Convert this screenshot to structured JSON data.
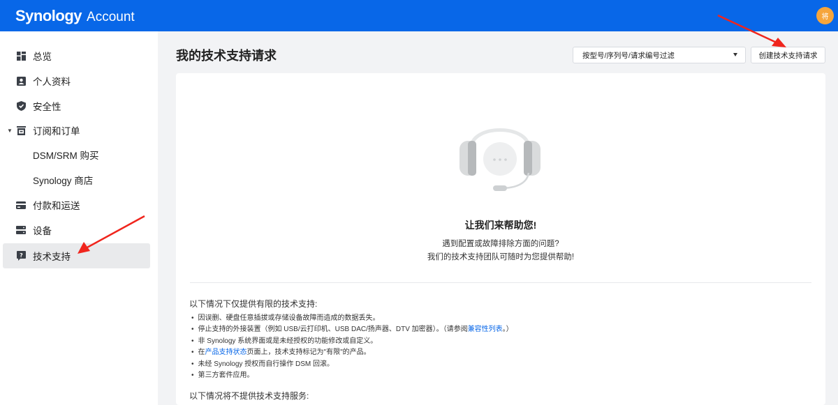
{
  "header": {
    "brand": "Synology",
    "product": "Account",
    "avatar_text": "将",
    "bar_color": "#0867e8"
  },
  "sidebar": {
    "items": [
      {
        "label": "总览",
        "icon": "dashboard-icon"
      },
      {
        "label": "个人资料",
        "icon": "profile-icon"
      },
      {
        "label": "安全性",
        "icon": "shield-icon"
      },
      {
        "label": "订阅和订单",
        "icon": "orders-icon",
        "expanded": true
      },
      {
        "label": "DSM/SRM 购买",
        "sub": true
      },
      {
        "label": "Synology 商店",
        "sub": true
      },
      {
        "label": "付款和运送",
        "icon": "credit-card-icon"
      },
      {
        "label": "设备",
        "icon": "device-icon"
      },
      {
        "label": "技术支持",
        "icon": "support-icon",
        "active": true
      }
    ]
  },
  "main": {
    "title": "我的技术支持请求",
    "filter_placeholder": "按型号/序列号/请求编号过滤",
    "create_button": "创建技术支持请求"
  },
  "help": {
    "title": "让我们来帮助您!",
    "line1": "遇到配置或故障排除方面的问题?",
    "line2": "我们的技术支持团队可随时为您提供帮助!"
  },
  "limited": {
    "heading": "以下情况下仅提供有限的技术支持:",
    "items": [
      "因误删、硬盘任意插拔或存储设备故障而造成的数据丢失。",
      {
        "before": "停止支持的外接装置（例如 USB/云打印机、USB DAC/扬声器、DTV 加密器）。（请参阅",
        "link": "兼容性列表",
        "after": "。）"
      },
      "非 Synology 系统界面或是未经授权的功能修改或自定义。",
      {
        "before": "在",
        "link": "产品支持状态",
        "after": "页面上，技术支持标记为\"有限\"的产品。"
      },
      "未经 Synology 授权而自行操作 DSM 回滚。",
      "第三方套件应用。"
    ]
  },
  "no_support": {
    "heading": "以下情况将不提供技术支持服务:"
  },
  "colors": {
    "accent": "#0867e8",
    "annotation_arrow": "#f0251d",
    "avatar": "#f6a53b"
  }
}
